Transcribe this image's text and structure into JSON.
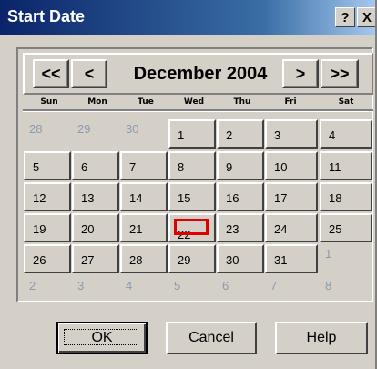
{
  "window": {
    "title": "Start Date"
  },
  "titlebar_buttons": {
    "help": "?",
    "close": "X"
  },
  "nav": {
    "prev_year": "<<",
    "prev_month": "<",
    "month_year": "December 2004",
    "next_month": ">",
    "next_year": ">>"
  },
  "weekdays": [
    "Sun",
    "Mon",
    "Tue",
    "Wed",
    "Thu",
    "Fri",
    "Sat"
  ],
  "weeks": [
    [
      {
        "d": "28",
        "in": false
      },
      {
        "d": "29",
        "in": false
      },
      {
        "d": "30",
        "in": false
      },
      {
        "d": "1",
        "in": true
      },
      {
        "d": "2",
        "in": true
      },
      {
        "d": "3",
        "in": true
      },
      {
        "d": "4",
        "in": true
      }
    ],
    [
      {
        "d": "5",
        "in": true
      },
      {
        "d": "6",
        "in": true
      },
      {
        "d": "7",
        "in": true
      },
      {
        "d": "8",
        "in": true
      },
      {
        "d": "9",
        "in": true
      },
      {
        "d": "10",
        "in": true
      },
      {
        "d": "11",
        "in": true
      }
    ],
    [
      {
        "d": "12",
        "in": true
      },
      {
        "d": "13",
        "in": true
      },
      {
        "d": "14",
        "in": true
      },
      {
        "d": "15",
        "in": true
      },
      {
        "d": "16",
        "in": true
      },
      {
        "d": "17",
        "in": true
      },
      {
        "d": "18",
        "in": true
      }
    ],
    [
      {
        "d": "19",
        "in": true
      },
      {
        "d": "20",
        "in": true
      },
      {
        "d": "21",
        "in": true
      },
      {
        "d": "22",
        "in": true,
        "selected": true
      },
      {
        "d": "23",
        "in": true
      },
      {
        "d": "24",
        "in": true
      },
      {
        "d": "25",
        "in": true
      }
    ],
    [
      {
        "d": "26",
        "in": true
      },
      {
        "d": "27",
        "in": true
      },
      {
        "d": "28",
        "in": true
      },
      {
        "d": "29",
        "in": true
      },
      {
        "d": "30",
        "in": true
      },
      {
        "d": "31",
        "in": true
      },
      {
        "d": "1",
        "in": false
      }
    ],
    [
      {
        "d": "2",
        "in": false
      },
      {
        "d": "3",
        "in": false
      },
      {
        "d": "4",
        "in": false
      },
      {
        "d": "5",
        "in": false
      },
      {
        "d": "6",
        "in": false
      },
      {
        "d": "7",
        "in": false
      },
      {
        "d": "8",
        "in": false
      }
    ]
  ],
  "buttons": {
    "ok": "OK",
    "cancel": "Cancel",
    "help_prefix": "H",
    "help_rest": "elp"
  },
  "colors": {
    "selected_border": "#e00000",
    "outside_month_text": "#8a9bb0",
    "title_bar": "#0a246a"
  }
}
